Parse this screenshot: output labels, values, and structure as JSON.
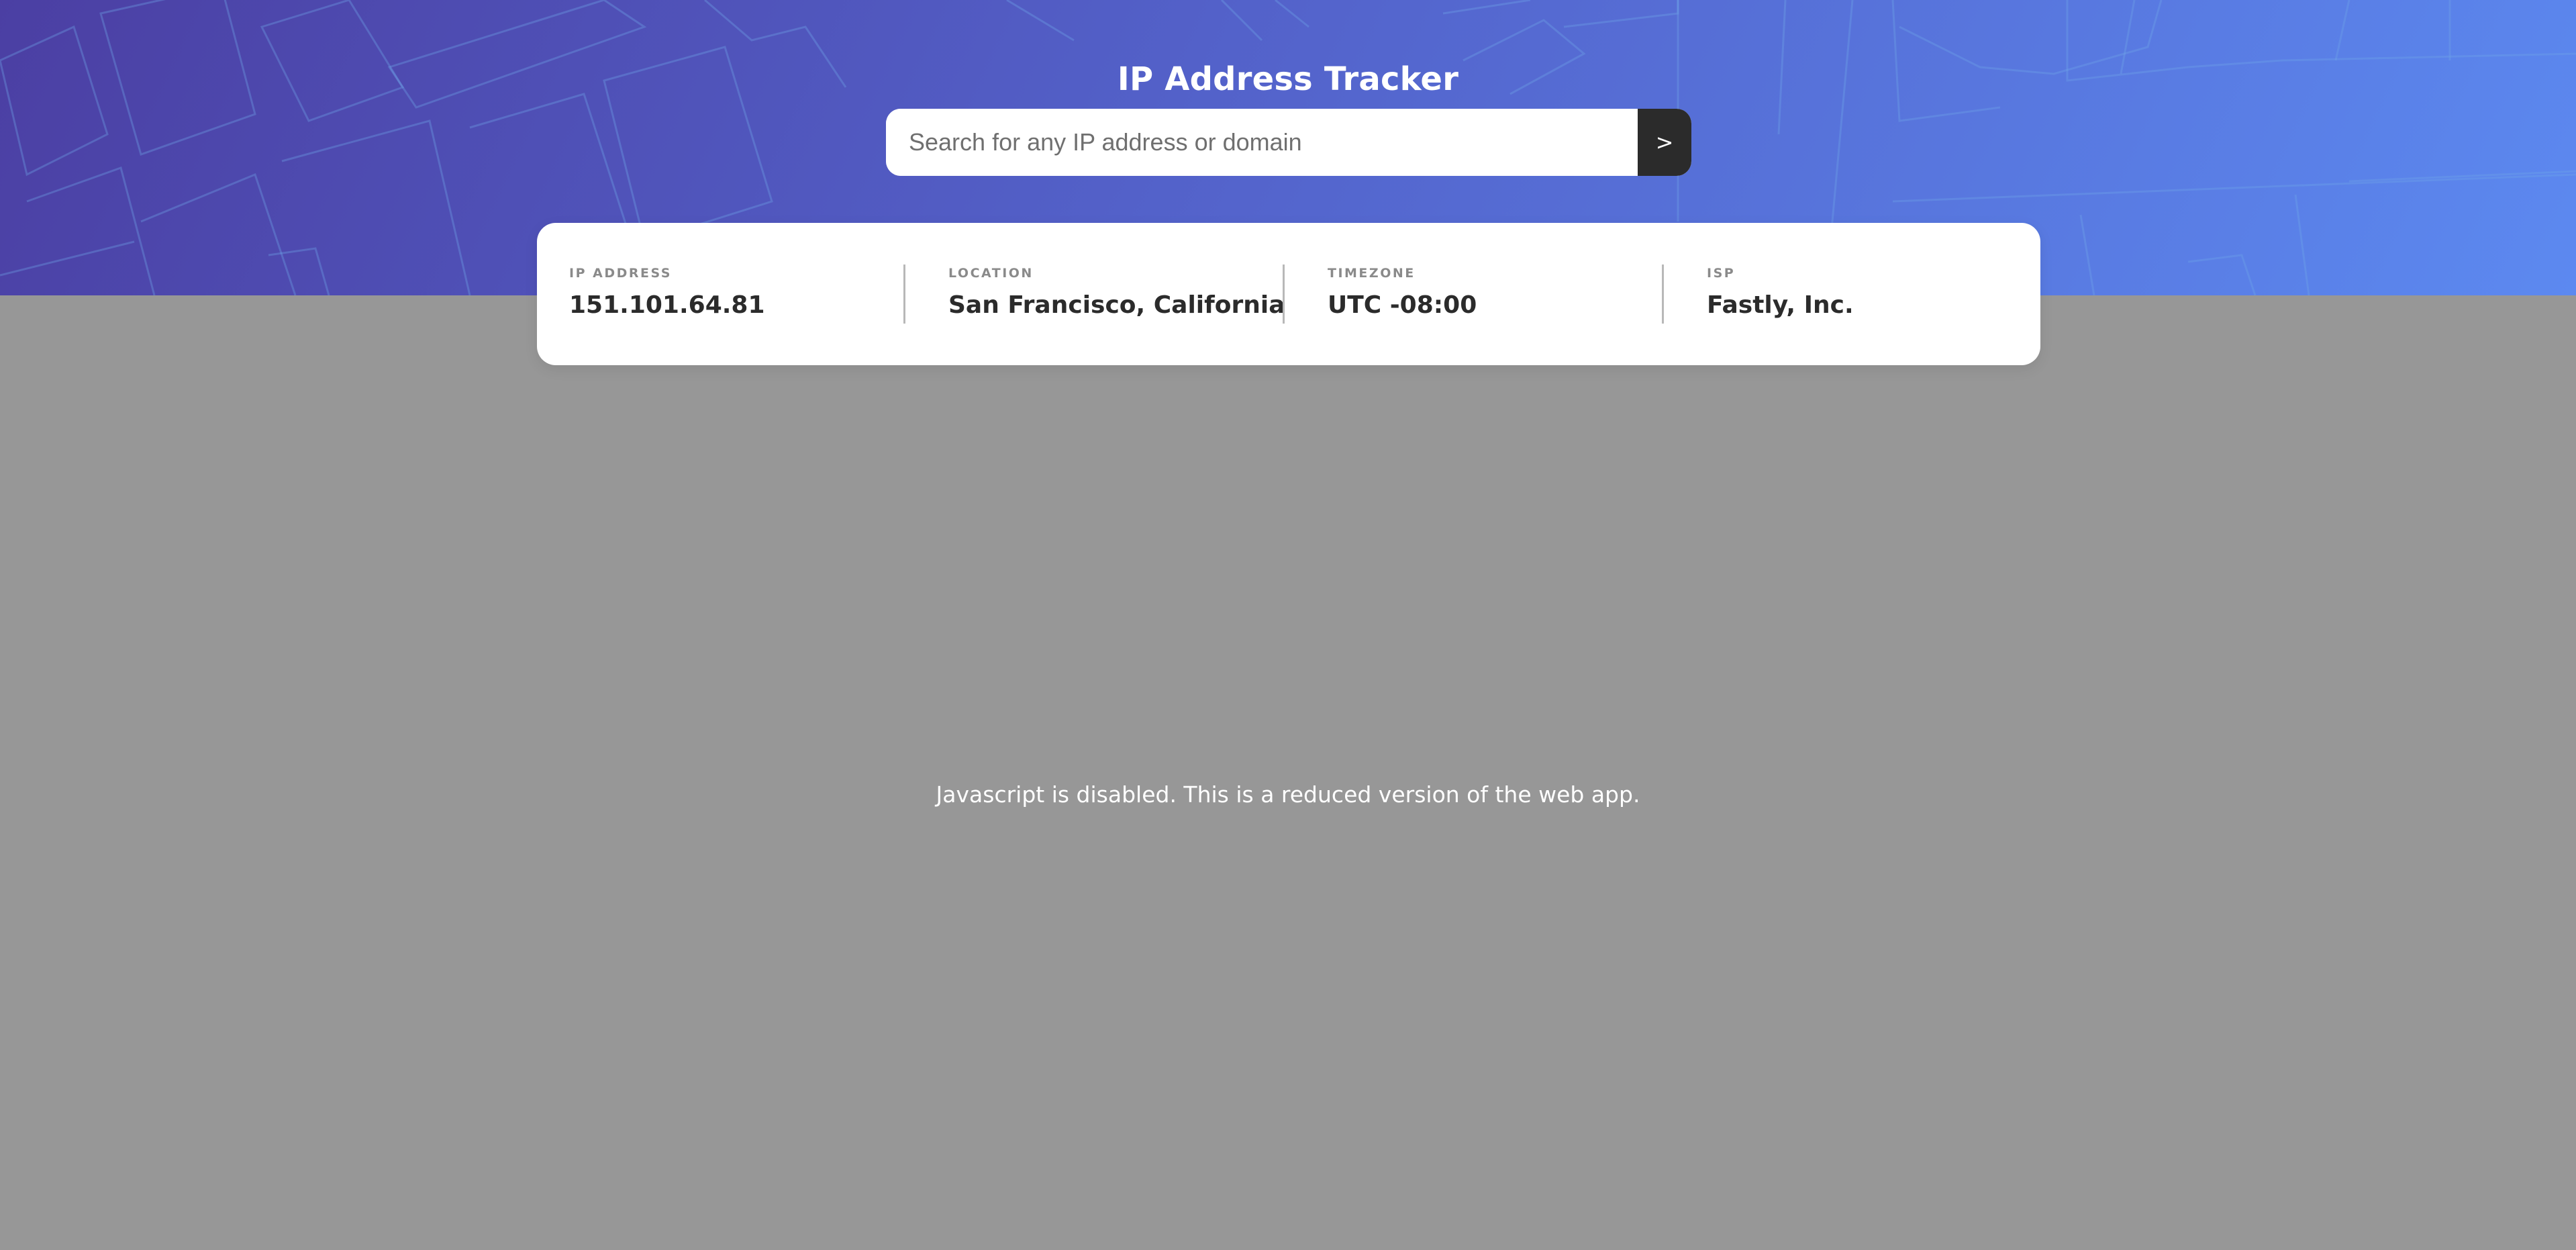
{
  "app": {
    "title": "IP Address Tracker"
  },
  "search": {
    "placeholder": "Search for any IP address or domain",
    "value": "",
    "submit_label": ">"
  },
  "info": [
    {
      "label": "IP ADDRESS",
      "value": "151.101.64.81"
    },
    {
      "label": "LOCATION",
      "value": "San Francisco, California"
    },
    {
      "label": "TIMEZONE",
      "value": "UTC -08:00"
    },
    {
      "label": "ISP",
      "value": "Fastly, Inc."
    }
  ],
  "map": {
    "notice": "Javascript is disabled. This is a reduced version of the web app."
  },
  "colors": {
    "header_gradient_start": "#4b3fa3",
    "header_gradient_end": "#5c89f0",
    "search_button": "#2b2b2b",
    "map_background": "#979797",
    "value_text": "#2b2b2b",
    "label_text": "#8a8a8a"
  }
}
